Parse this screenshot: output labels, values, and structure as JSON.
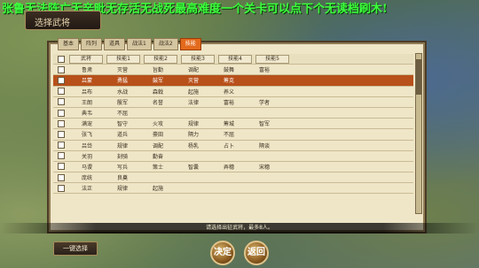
{
  "overlay_text": "张鲁无法阵亡无辛毗无存活无战死最高难度一个关卡可以点下个无读档刷木!",
  "title": "选择武将",
  "tabs": [
    "基本",
    "阵列",
    "道具",
    "战法1",
    "战法2",
    "技能"
  ],
  "header": [
    "武将",
    "技能1",
    "技能2",
    "技能3",
    "技能4",
    "技能5"
  ],
  "rows": [
    {
      "name": "鲁肃",
      "cells": [
        "灭营",
        "旨勤",
        "调配",
        "鼓舞",
        "富裕"
      ],
      "selected": false
    },
    {
      "name": "吕蒙",
      "cells": [
        "勇猛",
        "鼓军",
        "灭营",
        "筹克"
      ],
      "selected": true
    },
    {
      "name": "吕布",
      "cells": [
        "水战",
        "森戟",
        "起施",
        "养义"
      ],
      "selected": false
    },
    {
      "name": "王朗",
      "cells": [
        "殷军",
        "名誉",
        "法律",
        "富裕",
        "学者"
      ],
      "selected": false
    },
    {
      "name": "典韦",
      "cells": [
        "不屈"
      ],
      "selected": false
    },
    {
      "name": "满宠",
      "cells": [
        "智守",
        "火攻",
        "规律",
        "筹城",
        "智军"
      ],
      "selected": false
    },
    {
      "name": "张飞",
      "cells": [
        "道兵",
        "豪田",
        "隔力",
        "不屈"
      ],
      "selected": false
    },
    {
      "name": "吕岱",
      "cells": [
        "规律",
        "调配",
        "杨乳",
        "占卜",
        "隔谈"
      ],
      "selected": false
    },
    {
      "name": "关羽",
      "cells": [
        "刻骑",
        "勤奋"
      ],
      "selected": false
    },
    {
      "name": "马谡",
      "cells": [
        "写兵",
        "策士",
        "智囊",
        "弄穗",
        "宋穗"
      ],
      "selected": false
    },
    {
      "name": "庞统",
      "cells": [
        "良奠"
      ],
      "selected": false
    },
    {
      "name": "法正",
      "cells": [
        "规律",
        "起施"
      ],
      "selected": false
    }
  ],
  "status": "请选择出征武将，最多8人。",
  "buttons": {
    "select_all": "一键选择",
    "confirm": "决定",
    "back": "返回"
  }
}
